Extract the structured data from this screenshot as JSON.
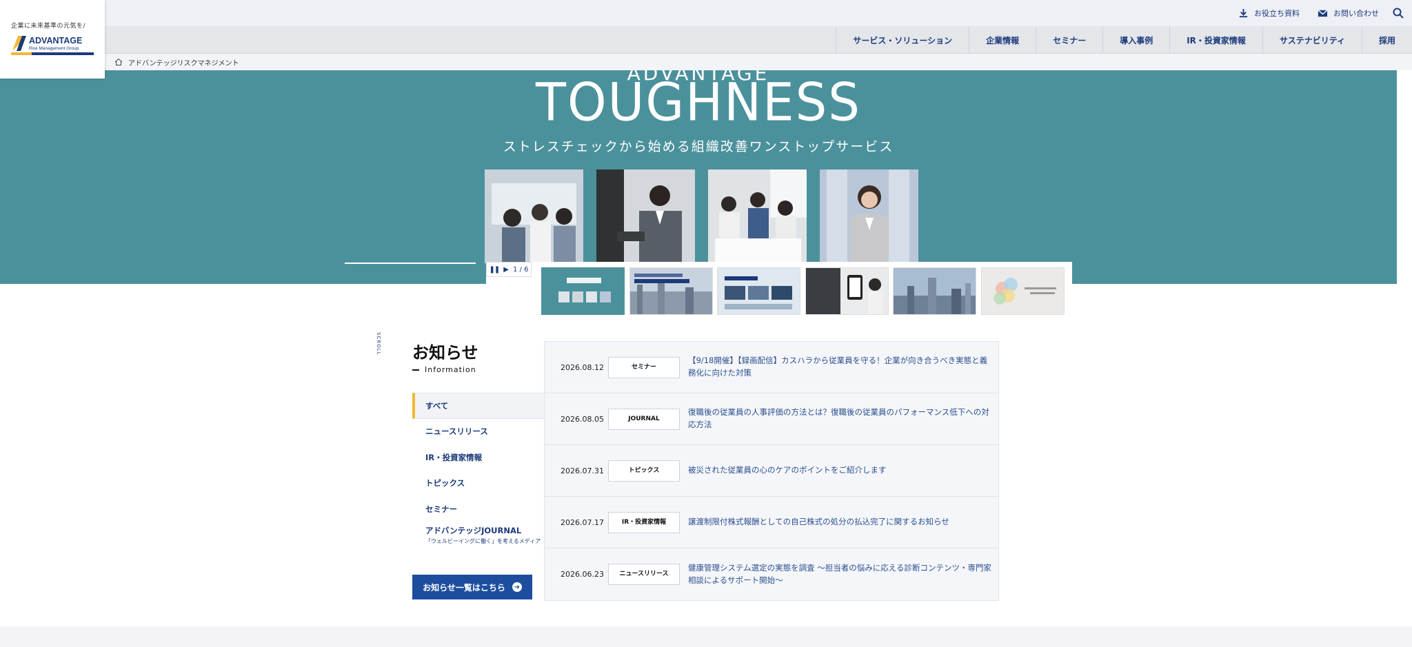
{
  "header": {
    "logo_tagline": "企業に未来基準の元気を/",
    "logo_name": "ADVANTAGE",
    "logo_group": "Risk Management Group",
    "util_links": [
      {
        "label": "お役立ち資料",
        "icon": "download-icon"
      },
      {
        "label": "お問い合わせ",
        "icon": "mail-icon"
      }
    ],
    "search_icon": "search-icon",
    "nav": [
      "サービス・ソリューション",
      "企業情報",
      "セミナー",
      "導入事例",
      "IR・投資家情報",
      "サステナビリティ",
      "採用"
    ],
    "breadcrumb": "アドバンテッジリスクマネジメント"
  },
  "hero": {
    "title_top": "ADVANTAGE",
    "title": "TOUGHNESS",
    "subtitle": "ストレスチェックから始める組織改善ワンストップサービス",
    "slide_counter": "1 / 6"
  },
  "news": {
    "scroll_label": "SCROLL",
    "title": "お知らせ",
    "subtitle": "Information",
    "categories": [
      {
        "label": "すべて",
        "note": ""
      },
      {
        "label": "ニュースリリース",
        "note": ""
      },
      {
        "label": "IR・投資家情報",
        "note": ""
      },
      {
        "label": "トピックス",
        "note": ""
      },
      {
        "label": "セミナー",
        "note": ""
      },
      {
        "label": "アドバンテッジJOURNAL",
        "note": "「ウェルビーイングに働く」を考えるメディア"
      }
    ],
    "more_label": "お知らせ一覧はこちら",
    "items": [
      {
        "date": "2026.08.12",
        "tag": "セミナー",
        "text": "【9/18開催】【録画配信】カスハラから従業員を守る！企業が向き合うべき実態と義務化に向けた対策"
      },
      {
        "date": "2026.08.05",
        "tag": "JOURNAL",
        "text": "復職後の従業員の人事評価の方法とは？復職後の従業員のパフォーマンス低下への対応方法"
      },
      {
        "date": "2026.07.31",
        "tag": "トピックス",
        "text": "被災された従業員の心のケアのポイントをご紹介します"
      },
      {
        "date": "2026.07.17",
        "tag": "IR・投資家情報",
        "text": "譲渡制限付株式報酬としての自己株式の処分の払込完了に関するお知らせ"
      },
      {
        "date": "2026.06.23",
        "tag": "ニュースリリース",
        "text": "健康管理システム選定の実態を調査 〜担当者の悩みに応える診断コンテンツ・専門家相談によるサポート開始〜"
      }
    ]
  },
  "colors": {
    "brand_navy": "#1b3a7a",
    "hero_teal": "#4b919c",
    "accent_yellow": "#f0b93a",
    "button_blue": "#1d4e9e"
  }
}
